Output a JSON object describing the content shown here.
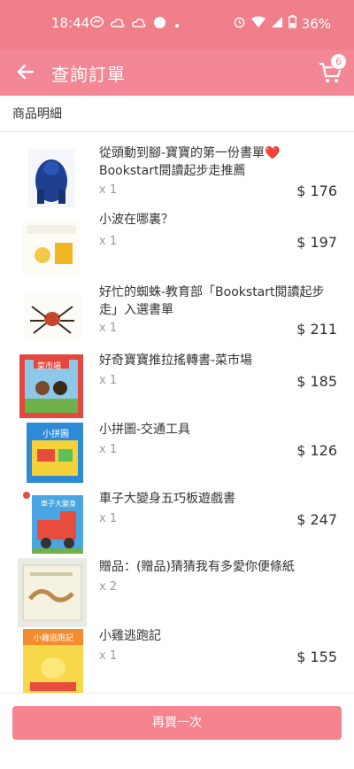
{
  "status_bar": {
    "time": "18:44",
    "battery": "36%",
    "icons": [
      "messenger-icon",
      "cloud-icon",
      "cloud-icon",
      "circle-icon",
      "dot-icon",
      "alarm-icon",
      "wifi-icon",
      "signal-icon",
      "battery-icon"
    ]
  },
  "header": {
    "title": "查詢訂單",
    "cart_badge": "6",
    "back_icon": "arrow-left-icon",
    "cart_icon": "shopping-cart-icon"
  },
  "section": {
    "title": "商品明細"
  },
  "items": [
    {
      "name": "從頭動到腳-寶寶的第一份書單❤️Bookstart閱讀起步走推薦",
      "qty": "x 1",
      "price": "$ 176"
    },
    {
      "name": "小波在哪裏？",
      "qty": "x 1",
      "price": "$ 197"
    },
    {
      "name": "好忙的蜘蛛-教育部「Bookstart閱讀起步走」入選書單",
      "qty": "x 1",
      "price": "$ 211"
    },
    {
      "name": "好奇寶寶推拉搖轉書-菜市場",
      "qty": "x 1",
      "price": "$ 185"
    },
    {
      "name": "小拼圖-交通工具",
      "qty": "x 1",
      "price": "$ 126"
    },
    {
      "name": "車子大變身五巧板遊戲書",
      "qty": "x 1",
      "price": "$ 247"
    },
    {
      "name": "贈品：(贈品)猜猜我有多愛你便條紙",
      "qty": "x 2",
      "price": ""
    },
    {
      "name": "小雞逃跑記",
      "qty": "x 1",
      "price": "$ 155"
    }
  ],
  "cover_text": {
    "book4": "菜市場",
    "book5": "小拼圖",
    "book6": "車子大變身",
    "book8": "小雞逃跑記"
  },
  "footer": {
    "rebuy_label": "再買一次"
  },
  "colors": {
    "header": "#f38795",
    "statusbar": "#f07f8b",
    "button": "#f5848f"
  }
}
